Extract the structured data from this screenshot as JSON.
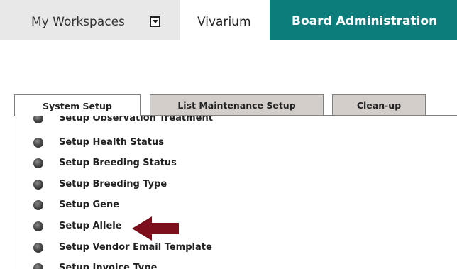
{
  "topnav": {
    "workspaces_label": "My Workspaces",
    "workspaces_dropdown_icon": "dropdown-arrow-icon",
    "vivarium_label": "Vivarium",
    "board_label": "Board Administration"
  },
  "tabs": [
    {
      "label": "System Setup",
      "active": true
    },
    {
      "label": "List Maintenance Setup",
      "active": false
    },
    {
      "label": "Clean-up",
      "active": false
    }
  ],
  "setup_list": [
    "Setup Observation Treatment",
    "Setup Health Status",
    "Setup Breeding Status",
    "Setup Breeding Type",
    "Setup Gene",
    "Setup Allele",
    "Setup Vendor Email Template",
    "Setup Invoice Type"
  ],
  "annotation": {
    "arrow_icon": "left-arrow-icon",
    "arrow_color": "#7d0f1c",
    "points_to": "Setup Allele"
  },
  "colors": {
    "accent_teal": "#0c7d7a",
    "inactive_tab": "#d4ceca",
    "nav_gray": "#e8e8e8"
  }
}
